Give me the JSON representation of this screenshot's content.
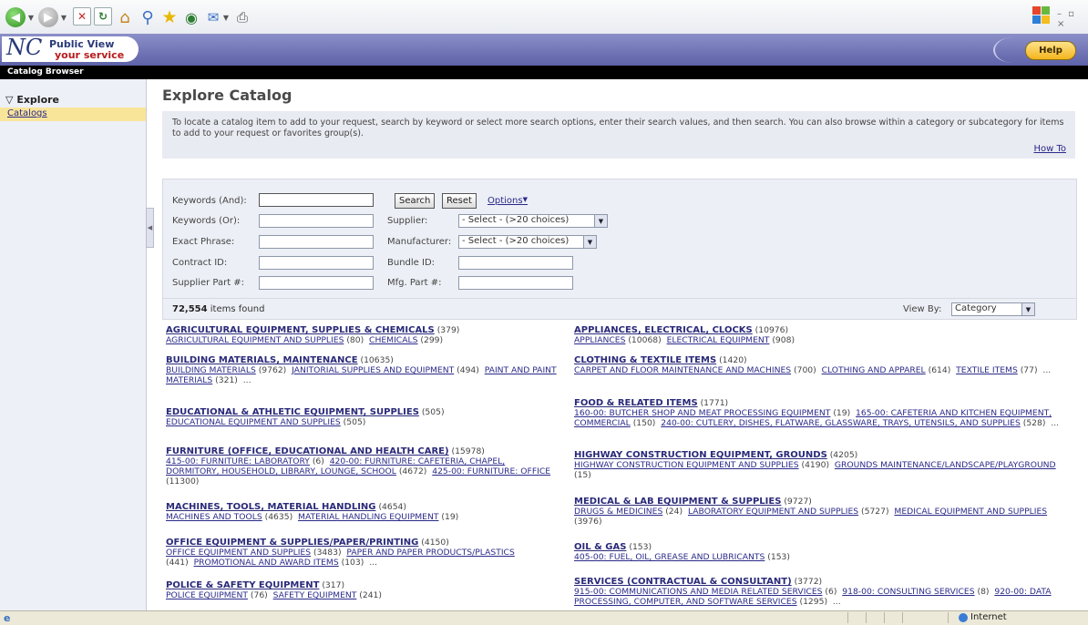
{
  "app": {
    "logo_public_view": "Public View",
    "logo_your_service": "your service",
    "breadcrumb": "Catalog Browser",
    "help_label": "Help"
  },
  "sidebar": {
    "section": "Explore",
    "items": [
      {
        "label": "Catalogs"
      }
    ]
  },
  "main": {
    "title": "Explore Catalog",
    "instructions": "To locate a catalog item to add to your request, search by keyword or select more search options, enter their search values, and then search. You can also browse within a category or subcategory for items to add to your request or favorites group(s).",
    "how_to": "How To"
  },
  "search": {
    "keywords_and": "Keywords (And):",
    "keywords_or": "Keywords (Or):",
    "exact_phrase": "Exact Phrase:",
    "contract_id": "Contract ID:",
    "supplier_part": "Supplier Part #:",
    "supplier": "Supplier:",
    "manufacturer": "Manufacturer:",
    "bundle_id": "Bundle ID:",
    "mfg_part": "Mfg. Part #:",
    "search_button": "Search",
    "reset_button": "Reset",
    "options_link": "Options",
    "supplier_value": "- Select - (>20 choices)",
    "manufacturer_value": "- Select - (>20 choices)",
    "items_found_count": "72,554",
    "items_found_text": "items found",
    "view_by_label": "View By:",
    "view_by_value": "Category"
  },
  "categories": {
    "left": [
      {
        "title": "AGRICULTURAL EQUIPMENT, SUPPLIES & CHEMICALS",
        "count": "(379)",
        "subs": [
          {
            "name": "AGRICULTURAL EQUIPMENT AND SUPPLIES",
            "count": "(80)"
          },
          {
            "name": "CHEMICALS",
            "count": "(299)"
          }
        ],
        "more": ""
      },
      {
        "title": "BUILDING MATERIALS, MAINTENANCE",
        "count": "(10635)",
        "subs": [
          {
            "name": "BUILDING MATERIALS",
            "count": "(9762)"
          },
          {
            "name": "JANITORIAL SUPPLIES AND EQUIPMENT",
            "count": "(494)"
          },
          {
            "name": "PAINT AND PAINT MATERIALS",
            "count": "(321)"
          }
        ],
        "more": "..."
      },
      {
        "title": "EDUCATIONAL & ATHLETIC EQUIPMENT, SUPPLIES",
        "count": "(505)",
        "subs": [
          {
            "name": "EDUCATIONAL EQUIPMENT AND SUPPLIES",
            "count": "(505)"
          }
        ],
        "more": ""
      },
      {
        "title": "FURNITURE (OFFICE, EDUCATIONAL AND HEALTH CARE)",
        "count": "(15978)",
        "subs": [
          {
            "name": "415-00: FURNITURE: LABORATORY",
            "count": "(6)"
          },
          {
            "name": "420-00: FURNITURE: CAFETERIA, CHAPEL, DORMITORY, HOUSEHOLD, LIBRARY, LOUNGE, SCHOOL",
            "count": "(4672)"
          },
          {
            "name": "425-00: FURNITURE: OFFICE",
            "count": "(11300)"
          }
        ],
        "more": ""
      },
      {
        "title": "MACHINES, TOOLS, MATERIAL HANDLING",
        "count": "(4654)",
        "subs": [
          {
            "name": "MACHINES AND TOOLS",
            "count": "(4635)"
          },
          {
            "name": "MATERIAL HANDLING EQUIPMENT",
            "count": "(19)"
          }
        ],
        "more": ""
      },
      {
        "title": "OFFICE EQUIPMENT & SUPPLIES/PAPER/PRINTING",
        "count": "(4150)",
        "subs": [
          {
            "name": "OFFICE EQUIPMENT AND SUPPLIES",
            "count": "(3483)"
          },
          {
            "name": "PAPER AND PAPER PRODUCTS/PLASTICS",
            "count": "(441)"
          },
          {
            "name": "PROMOTIONAL AND AWARD ITEMS",
            "count": "(103)"
          }
        ],
        "more": "..."
      },
      {
        "title": "POLICE & SAFETY EQUIPMENT",
        "count": "(317)",
        "subs": [
          {
            "name": "POLICE EQUIPMENT",
            "count": "(76)"
          },
          {
            "name": "SAFETY EQUIPMENT",
            "count": "(241)"
          }
        ],
        "more": ""
      }
    ],
    "right": [
      {
        "title": "APPLIANCES, ELECTRICAL, CLOCKS",
        "count": "(10976)",
        "subs": [
          {
            "name": "APPLIANCES",
            "count": "(10068)"
          },
          {
            "name": "ELECTRICAL EQUIPMENT",
            "count": "(908)"
          }
        ],
        "more": ""
      },
      {
        "title": "CLOTHING & TEXTILE ITEMS",
        "count": "(1420)",
        "subs": [
          {
            "name": "CARPET AND FLOOR MAINTENANCE AND MACHINES",
            "count": "(700)"
          },
          {
            "name": "CLOTHING AND APPAREL",
            "count": "(614)"
          },
          {
            "name": "TEXTILE ITEMS",
            "count": "(77)"
          }
        ],
        "more": "..."
      },
      {
        "title": "FOOD & RELATED ITEMS",
        "count": "(1771)",
        "subs": [
          {
            "name": "160-00: BUTCHER SHOP AND MEAT PROCESSING EQUIPMENT",
            "count": "(19)"
          },
          {
            "name": "165-00: CAFETERIA AND KITCHEN EQUIPMENT, COMMERCIAL",
            "count": "(150)"
          },
          {
            "name": "240-00: CUTLERY, DISHES, FLATWARE, GLASSWARE, TRAYS, UTENSILS, AND SUPPLIES",
            "count": "(528)"
          }
        ],
        "more": "..."
      },
      {
        "title": "HIGHWAY CONSTRUCTION EQUIPMENT, GROUNDS",
        "count": "(4205)",
        "subs": [
          {
            "name": "HIGHWAY CONSTRUCTION EQUIPMENT AND SUPPLIES",
            "count": "(4190)"
          },
          {
            "name": "GROUNDS MAINTENANCE/LANDSCAPE/PLAYGROUND",
            "count": "(15)"
          }
        ],
        "more": ""
      },
      {
        "title": "MEDICAL & LAB EQUIPMENT & SUPPLIES",
        "count": "(9727)",
        "subs": [
          {
            "name": "DRUGS & MEDICINES",
            "count": "(24)"
          },
          {
            "name": "LABORATORY EQUIPMENT AND SUPPLIES",
            "count": "(5727)"
          },
          {
            "name": "MEDICAL EQUIPMENT AND SUPPLIES",
            "count": "(3976)"
          }
        ],
        "more": ""
      },
      {
        "title": "OIL & GAS",
        "count": "(153)",
        "subs": [
          {
            "name": "405-00: FUEL, OIL, GREASE AND LUBRICANTS",
            "count": "(153)"
          }
        ],
        "more": ""
      },
      {
        "title": "SERVICES (CONTRACTUAL & CONSULTANT)",
        "count": "(3772)",
        "subs": [
          {
            "name": "915-00: COMMUNICATIONS AND MEDIA RELATED SERVICES",
            "count": "(6)"
          },
          {
            "name": "918-00: CONSULTING SERVICES",
            "count": "(8)"
          },
          {
            "name": "920-00: DATA PROCESSING, COMPUTER, AND SOFTWARE SERVICES",
            "count": "(1295)"
          }
        ],
        "more": "..."
      }
    ]
  },
  "statusbar": {
    "zone": "Internet"
  },
  "colors": {
    "header": "#6a6eb2",
    "link": "#2a2a8a",
    "nav_highlight": "#f9e59a",
    "panel": "#eceff5"
  }
}
